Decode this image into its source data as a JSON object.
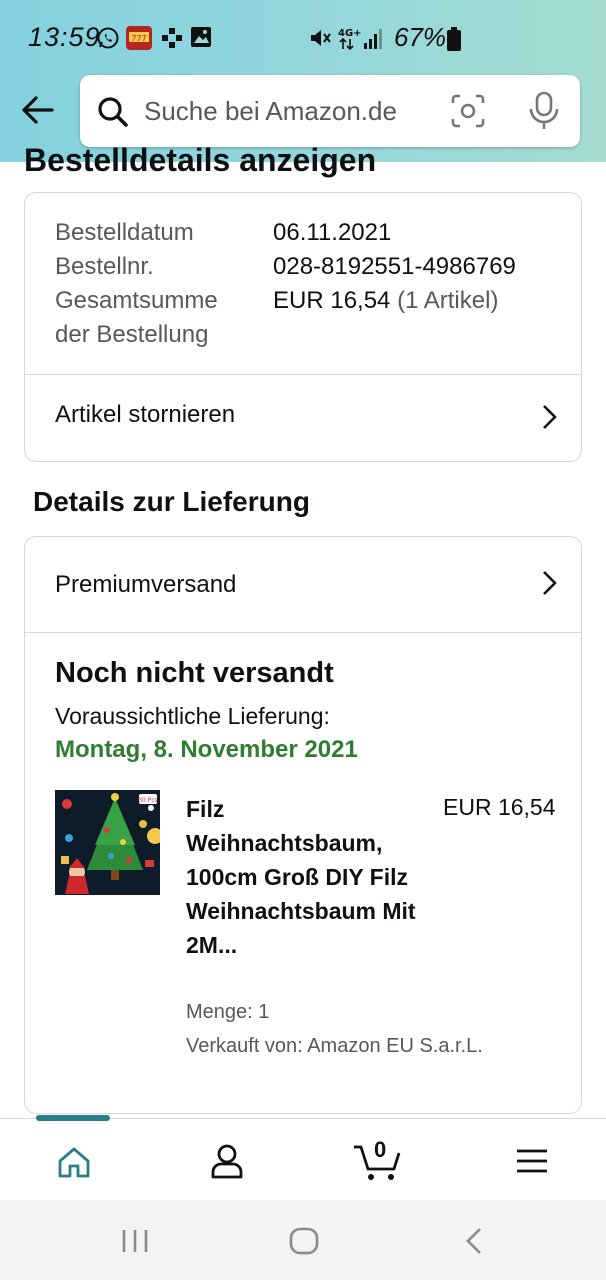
{
  "status_bar": {
    "time": "13:59",
    "battery_percent": "67%"
  },
  "search": {
    "placeholder": "Suche bei Amazon.de"
  },
  "page_title": "Bestelldetails anzeigen",
  "order": {
    "rows": [
      {
        "label": "Bestelldatum",
        "value": "06.11.2021"
      },
      {
        "label": "Bestellnr.",
        "value": "028-8192551-4986769"
      },
      {
        "label": "Gesamtsumme",
        "label2": "der Bestellung",
        "value": "EUR 16,54",
        "value_extra": "(1 Artikel)"
      }
    ],
    "cancel_label": "Artikel stornieren"
  },
  "delivery": {
    "section_title": "Details zur Lieferung",
    "shipping_method": "Premiumversand",
    "status": "Noch nicht versandt",
    "expected_label": "Voraussichtliche Lieferung:",
    "expected_date": "Montag, 8. November 2021",
    "accent_color": "#2f7d31",
    "product": {
      "title": "Filz Weihnachtsbaum, 100cm Groß DIY Filz Weihnachtsbaum Mit 2M...",
      "price": "EUR 16,54",
      "quantity": "Menge: 1",
      "seller": "Verkauft von: Amazon EU S.a.r.L.",
      "image_badge": "30 Pcs"
    }
  },
  "bottom_nav": {
    "items": [
      "home-icon",
      "account-icon",
      "cart-icon",
      "menu-icon"
    ],
    "cart_count": "0",
    "active": "home"
  }
}
